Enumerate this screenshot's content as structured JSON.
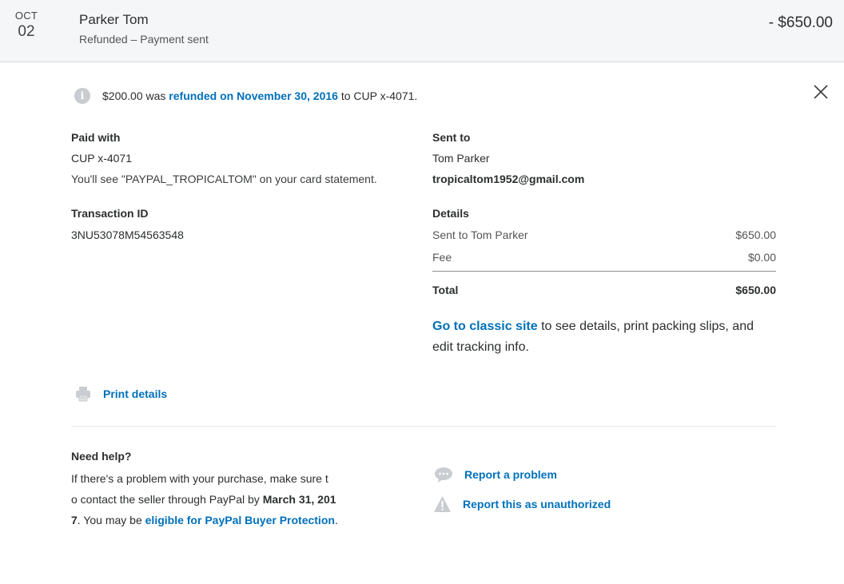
{
  "header": {
    "month": "OCT",
    "day": "02",
    "name": "Parker Tom",
    "status": "Refunded – Payment sent",
    "amount": "- $650.00"
  },
  "notice": {
    "amount": "$200.00",
    "was": "was",
    "link": "refunded on November 30, 2016",
    "suffix": "to CUP x-4071."
  },
  "paid_with": {
    "label": "Paid with",
    "card": "CUP x-4071",
    "statement": "You'll see \"PAYPAL_TROPICALTOM\" on your card statement."
  },
  "transaction": {
    "label": "Transaction ID",
    "id": "3NU53078M54563548"
  },
  "sent_to": {
    "label": "Sent to",
    "name": "Tom Parker",
    "email": "tropicaltom1952@gmail.com"
  },
  "details": {
    "label": "Details",
    "rows": [
      {
        "label": "Sent to Tom Parker",
        "value": "$650.00"
      },
      {
        "label": "Fee",
        "value": "$0.00"
      }
    ],
    "total_label": "Total",
    "total_value": "$650.00"
  },
  "classic": {
    "link": "Go to classic site",
    "text": "to see details, print packing slips, and edit tracking info."
  },
  "print": {
    "label": "Print details"
  },
  "help": {
    "title": "Need help?",
    "line1": "If there's a problem with your purchase, make sure t",
    "line2a": "o contact the seller through PayPal by",
    "line2b": "March 31, 201",
    "line3a": "7",
    "line3b": ". You may be",
    "line3link": "eligible for PayPal Buyer Protection",
    "line3c": "."
  },
  "actions": {
    "report_problem": "Report a problem",
    "report_unauthorized": "Report this as unauthorized"
  },
  "colors": {
    "link": "#0070ba",
    "header_bg": "#f5f6f7",
    "text": "#2c2e2f"
  }
}
